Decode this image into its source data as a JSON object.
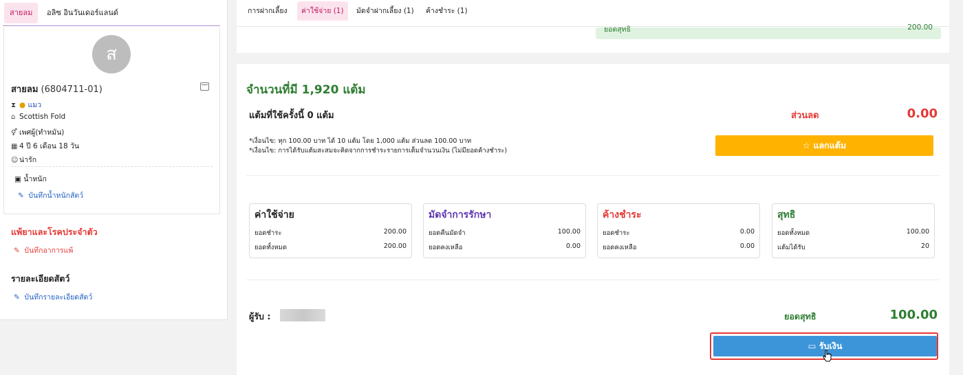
{
  "left": {
    "tabs": [
      "สายลม",
      "อลิซ อินวันเดอร์แลนด์"
    ],
    "avatar_letter": "ส",
    "pet_name": "สายลม",
    "pet_id": "(6804711-01)",
    "species": "แมว",
    "breed": "Scottish Fold",
    "sex": "เพศผู้(ทำหมัน)",
    "age": "4 ปี 6 เดือน 18 วัน",
    "temperament": "น่ารัก",
    "weight_label": "น้ำหนัก",
    "weight_link": "บันทึกน้ำหนักสัตว์",
    "allergy_heading": "แพ้ยาและโรคประจำตัว",
    "allergy_link": "บันทึกอาการแพ้",
    "detail_heading": "รายละเอียดสัตว์",
    "detail_link": "บันทึกรายละเอียดสัตว์"
  },
  "top_tabs": [
    "การฝากเลี้ยง",
    "ค่าใช้จ่าย (1)",
    "มัดจำฝากเลี้ยง (1)",
    "ค้างชำระ (1)"
  ],
  "net_strip": {
    "label": "ยอดสุทธิ",
    "value": "200.00"
  },
  "points": {
    "title": "จำนวนที่มี 1,920 แต้ม",
    "used": "แต้มที่ใช้ครั้งนี้ 0 แต้ม",
    "discount_label": "ส่วนลด",
    "discount_value": "0.00",
    "condition_1": "*เงื่อนไข: ทุก 100.00 บาท ได้ 10 แต้ม โดย 1,000 แต้ม ส่วนลด 100.00 บาท",
    "condition_2": "*เงื่อนไข: การได้รับแต้มสะสมจะคิดจากการชำระรายการเต็มจำนวนเงิน (ไม่มียอดค้างชำระ)",
    "redeem_button": "แลกแต้ม"
  },
  "summary": [
    {
      "title": "ค่าใช้จ่าย",
      "color": "#222222",
      "rows": [
        {
          "label": "ยอดชำระ",
          "value": "200.00"
        },
        {
          "label": "ยอดทั้งหมด",
          "value": "200.00"
        }
      ]
    },
    {
      "title": "มัดจำการรักษา",
      "color": "#5e35b1",
      "rows": [
        {
          "label": "ยอดคืนมัดจำ",
          "value": "100.00"
        },
        {
          "label": "ยอดคงเหลือ",
          "value": "0.00"
        }
      ]
    },
    {
      "title": "ค้างชำระ",
      "color": "#e53935",
      "rows": [
        {
          "label": "ยอดชำระ",
          "value": "0.00"
        },
        {
          "label": "ยอดคงเหลือ",
          "value": "0.00"
        }
      ]
    },
    {
      "title": "สุทธิ",
      "color": "#2e7d32",
      "rows": [
        {
          "label": "ยอดทั้งหมด",
          "value": "100.00"
        },
        {
          "label": "แต้มได้รับ",
          "value": "20"
        }
      ]
    }
  ],
  "footer": {
    "receiver_label": "ผู้รับ :",
    "net_label": "ยอดสุทธิ",
    "net_value": "100.00",
    "pay_button": "รับเงิน"
  }
}
